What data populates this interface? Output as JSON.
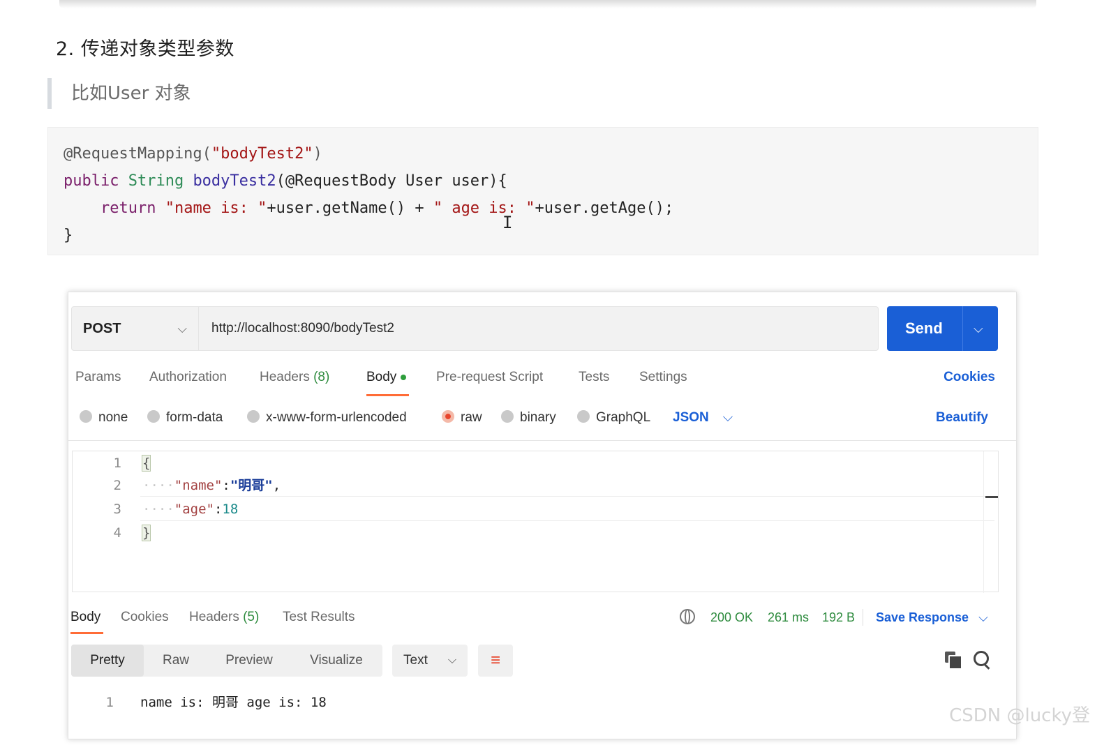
{
  "doc": {
    "heading": "2. 传递对象类型参数",
    "quote": "比如User 对象",
    "code": {
      "l1_ann": "@RequestMapping(",
      "l1_str": "\"bodyTest2\"",
      "l1_end": ")",
      "l2_kw": "public ",
      "l2_type": "String ",
      "l2_fn": "bodyTest2",
      "l2_rest": "(@RequestBody User user){",
      "l3_indent": "    ",
      "l3_kw": "return ",
      "l3_s1": "\"name is: \"",
      "l3_m1": "+user.getName() + ",
      "l3_s2": "\" age is: \"",
      "l3_m2": "+user.getAge();",
      "l4": "}"
    }
  },
  "postman": {
    "method": "POST",
    "url": "http://localhost:8090/bodyTest2",
    "send_label": "Send",
    "request_tabs": {
      "params": "Params",
      "authorization": "Authorization",
      "headers": "Headers",
      "headers_count": "(8)",
      "body": "Body",
      "prerequest": "Pre-request Script",
      "tests": "Tests",
      "settings": "Settings",
      "cookies": "Cookies"
    },
    "body_options": {
      "none": "none",
      "form_data": "form-data",
      "urlencoded": "x-www-form-urlencoded",
      "raw": "raw",
      "binary": "binary",
      "graphql": "GraphQL",
      "format": "JSON",
      "beautify": "Beautify"
    },
    "editor": {
      "line_numbers": [
        "1",
        "2",
        "3",
        "4"
      ],
      "open_brace": "{",
      "dots": "····",
      "key1": "\"name\"",
      "colon": ":",
      "val1": "\"明哥\"",
      "comma": ",",
      "key2": "\"age\"",
      "val2": "18",
      "close_brace": "}"
    },
    "response_tabs": {
      "body": "Body",
      "cookies": "Cookies",
      "headers": "Headers",
      "headers_count": "(5)",
      "test_results": "Test Results"
    },
    "status": {
      "code": "200 OK",
      "time": "261 ms",
      "size": "192 B",
      "save": "Save Response"
    },
    "view_modes": {
      "pretty": "Pretty",
      "raw": "Raw",
      "preview": "Preview",
      "visualize": "Visualize"
    },
    "response_format": "Text",
    "response_body": {
      "line": "1",
      "text": "name is: 明哥 age is: 18"
    }
  },
  "watermark": "CSDN @lucky登",
  "colors": {
    "send_blue": "#1a5fd6",
    "accent_orange": "#ff6c37",
    "status_green": "#2e8b3e"
  }
}
